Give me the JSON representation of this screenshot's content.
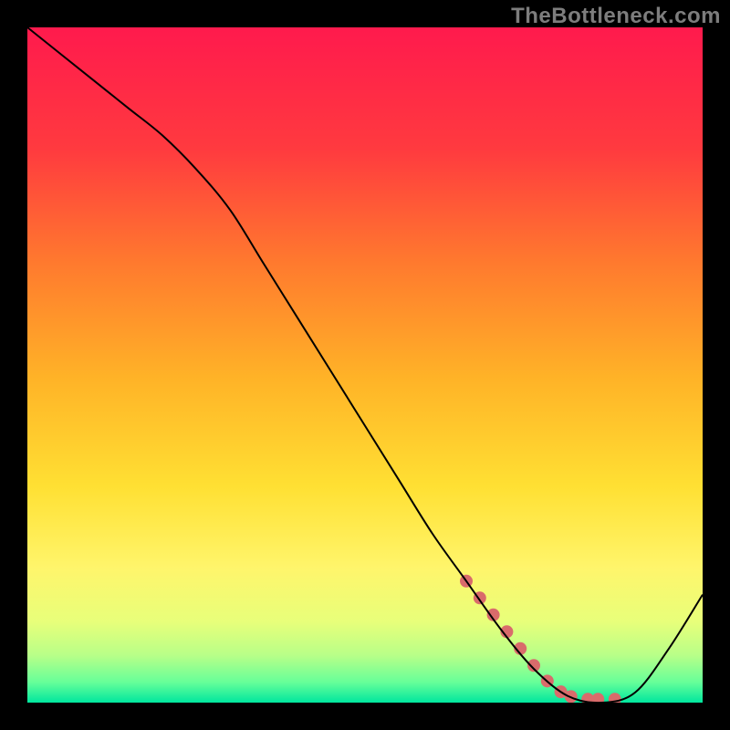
{
  "watermark": "TheBottleneck.com",
  "chart_data": {
    "type": "line",
    "title": "",
    "xlabel": "",
    "ylabel": "",
    "xlim": [
      0,
      100
    ],
    "ylim": [
      0,
      100
    ],
    "x": [
      0,
      5,
      10,
      15,
      20,
      25,
      30,
      35,
      40,
      45,
      50,
      55,
      60,
      65,
      70,
      75,
      80,
      85,
      90,
      95,
      100
    ],
    "y": [
      100,
      96,
      92,
      88,
      84,
      79,
      73,
      65,
      57,
      49,
      41,
      33,
      25,
      18,
      11,
      5,
      1,
      0,
      1.5,
      8,
      16
    ],
    "marker_points": {
      "x": [
        65,
        67,
        69,
        71,
        73,
        75,
        77,
        79,
        80.5,
        83,
        84.5,
        87
      ],
      "y": [
        18,
        15.5,
        13,
        10.5,
        8,
        5.5,
        3.2,
        1.6,
        0.9,
        0.5,
        0.5,
        0.5
      ]
    },
    "gradient_stops": [
      {
        "offset": 0.0,
        "color": "#ff1a4d"
      },
      {
        "offset": 0.18,
        "color": "#ff3a3f"
      },
      {
        "offset": 0.35,
        "color": "#ff7a2e"
      },
      {
        "offset": 0.52,
        "color": "#ffb327"
      },
      {
        "offset": 0.68,
        "color": "#ffe033"
      },
      {
        "offset": 0.8,
        "color": "#fff56b"
      },
      {
        "offset": 0.88,
        "color": "#e8ff7a"
      },
      {
        "offset": 0.93,
        "color": "#b8ff88"
      },
      {
        "offset": 0.97,
        "color": "#66ff99"
      },
      {
        "offset": 1.0,
        "color": "#00e69e"
      }
    ],
    "line_color": "#000000",
    "marker_color": "#d96b6b",
    "line_width": 2,
    "marker_radius": 7
  }
}
